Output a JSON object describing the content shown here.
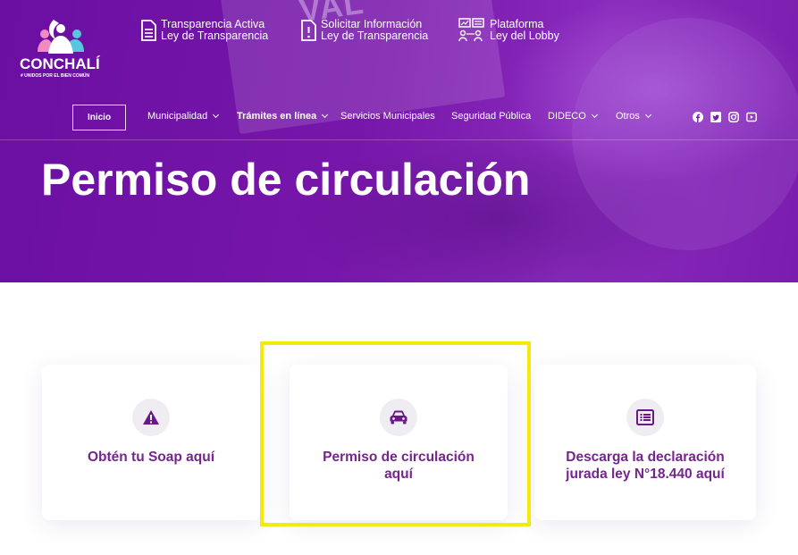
{
  "header": {
    "logo": {
      "name": "CONCHALÍ",
      "tagline": "# UNIDOS POR EL BIEN COMÚN"
    },
    "hero_watermark": "VAL",
    "top_links": [
      {
        "line1": "Transparencia Activa",
        "line2": "Ley de Transparencia",
        "icon": "document-icon"
      },
      {
        "line1": "Solicitar Información",
        "line2": "Ley de Transparencia",
        "icon": "alert-document-icon"
      },
      {
        "line1": "Plataforma",
        "line2": "Ley del Lobby",
        "icon": "org-chart-icon"
      }
    ],
    "nav": {
      "home": "Inicio",
      "items": [
        "Municipalidad",
        "Trámites en línea",
        "Servicios Municipales",
        "Seguridad Pública",
        "DIDECO",
        "Otros"
      ]
    },
    "social": [
      "facebook-icon",
      "twitter-icon",
      "instagram-icon",
      "youtube-icon"
    ]
  },
  "page": {
    "title": "Permiso de circulación"
  },
  "cards": [
    {
      "label_line1": "Obtén tu Soap aquí",
      "label_line2": "",
      "icon": "warning-icon"
    },
    {
      "label_line1": "Permiso de circulación",
      "label_line2": "aquí",
      "icon": "car-icon"
    },
    {
      "label_line1": "Descarga la declaración",
      "label_line2": "jurada ley N°18.440 aquí",
      "icon": "list-icon"
    }
  ],
  "colors": {
    "brand_purple": "#7716aa",
    "card_text": "#76248e",
    "highlight": "#f4ea0c"
  }
}
